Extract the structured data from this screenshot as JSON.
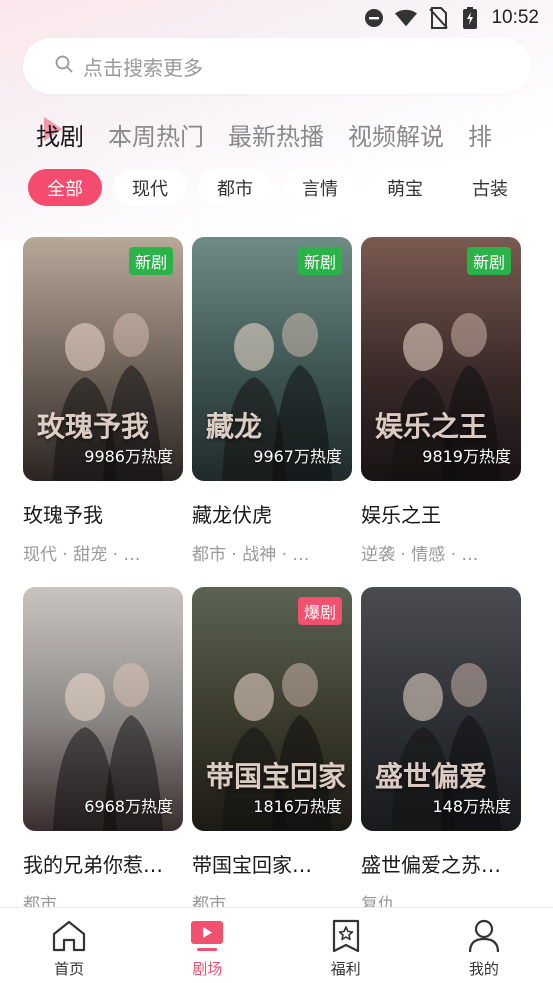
{
  "status_bar": {
    "time": "10:52"
  },
  "search": {
    "placeholder": "点击搜索更多"
  },
  "tabs": [
    {
      "label": "找剧",
      "active": true
    },
    {
      "label": "本周热门",
      "active": false
    },
    {
      "label": "最新热播",
      "active": false
    },
    {
      "label": "视频解说",
      "active": false
    },
    {
      "label": "排",
      "active": false
    }
  ],
  "filters": [
    {
      "label": "全部",
      "active": true
    },
    {
      "label": "现代",
      "active": false
    },
    {
      "label": "都市",
      "active": false
    },
    {
      "label": "言情",
      "active": false
    },
    {
      "label": "萌宝",
      "active": false
    },
    {
      "label": "古装",
      "active": false
    }
  ],
  "dramas": [
    {
      "title": "玫瑰予我",
      "tags": "现代 · 甜宠 · …",
      "badge": "新剧",
      "badge_type": "new",
      "heat": "9986万热度",
      "poster_text": "玫瑰予我",
      "colors": [
        "#b8a89a",
        "#6e6258",
        "#2a2422"
      ]
    },
    {
      "title": "藏龙伏虎",
      "tags": "都市 · 战神 · …",
      "badge": "新剧",
      "badge_type": "new",
      "heat": "9967万热度",
      "poster_text": "藏龙",
      "colors": [
        "#6f8b86",
        "#3e5552",
        "#1f2a29"
      ]
    },
    {
      "title": "娱乐之王",
      "tags": "逆袭 · 情感 · …",
      "badge": "新剧",
      "badge_type": "new",
      "heat": "9819万热度",
      "poster_text": "娱乐之王",
      "colors": [
        "#7a5a50",
        "#3b2b2a",
        "#181214"
      ]
    },
    {
      "title": "我的兄弟你惹…",
      "tags": "都市",
      "badge": "",
      "badge_type": "",
      "heat": "6968万热度",
      "poster_text": "",
      "colors": [
        "#c9c4c0",
        "#8a8683",
        "#3a2d2d"
      ]
    },
    {
      "title": "带国宝回家…",
      "tags": "都市",
      "badge": "爆剧",
      "badge_type": "hot",
      "heat": "1816万热度",
      "poster_text": "带国宝回家",
      "colors": [
        "#5a6354",
        "#3a3a2c",
        "#1c1a14"
      ]
    },
    {
      "title": "盛世偏爱之苏…",
      "tags": "复仇",
      "badge": "",
      "badge_type": "",
      "heat": "148万热度",
      "poster_text": "盛世偏爱",
      "colors": [
        "#4a4c52",
        "#2c2f34",
        "#181a1d"
      ]
    }
  ],
  "bottom_nav": [
    {
      "label": "首页",
      "icon": "home-icon",
      "active": false
    },
    {
      "label": "剧场",
      "icon": "theater-icon",
      "active": true
    },
    {
      "label": "福利",
      "icon": "welfare-icon",
      "active": false
    },
    {
      "label": "我的",
      "icon": "profile-icon",
      "active": false
    }
  ],
  "colors": {
    "accent": "#f44b6e",
    "badge_new": "#2bb34a",
    "badge_hot": "#f0516e"
  }
}
